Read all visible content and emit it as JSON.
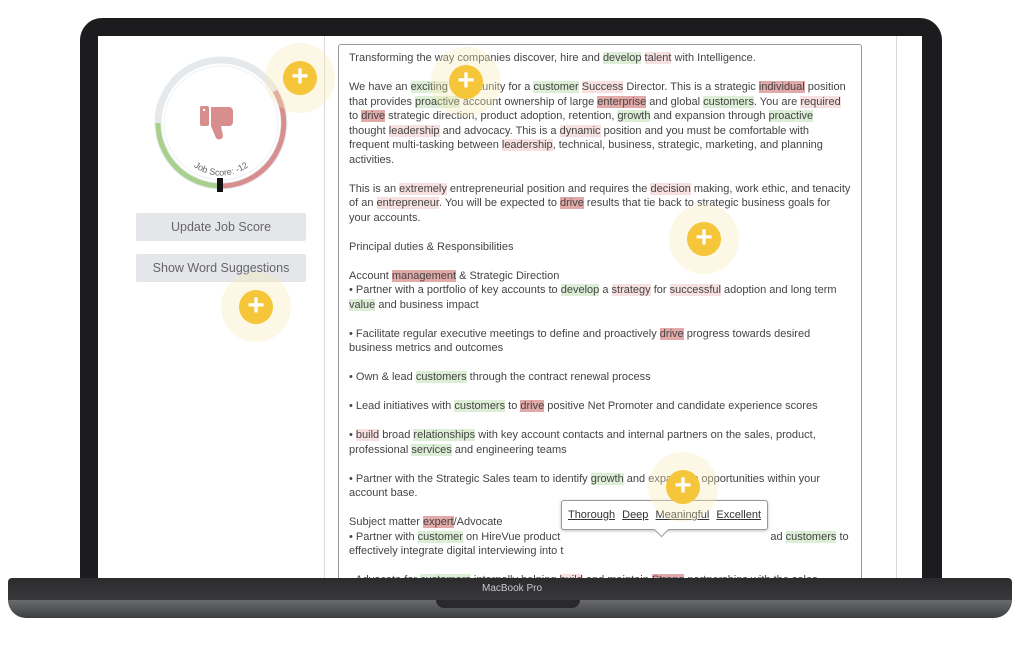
{
  "device": {
    "label": "MacBook Pro"
  },
  "score": {
    "label": "Job Score: -12",
    "value": -12,
    "icon": "thumbs-down-icon",
    "positive_color": "#a8d08d",
    "negative_color": "#d98e8e"
  },
  "buttons": {
    "update": "Update Job Score",
    "suggestions": "Show Word Suggestions"
  },
  "highlight_colors": {
    "positive": "#dcefd6",
    "negative_light": "#f7e0e0",
    "negative_strong": "#e2a9a9",
    "accent": "#f5c53a"
  },
  "tooltip": {
    "suggestions": [
      "Thorough",
      "Deep",
      "Meaningful",
      "Excellent"
    ]
  },
  "paragraphs": [
    [
      {
        "t": "Transforming the way companies discover, hire and "
      },
      {
        "t": "develop",
        "h": "g"
      },
      {
        "t": " "
      },
      {
        "t": "talent",
        "h": "r"
      },
      {
        "t": " with Intelligence."
      }
    ],
    [
      {
        "t": "We have an "
      },
      {
        "t": "exciting",
        "h": "g"
      },
      {
        "t": " opportunity for a "
      },
      {
        "t": "customer",
        "h": "g"
      },
      {
        "t": " "
      },
      {
        "t": "Success",
        "h": "r"
      },
      {
        "t": " Director. This is a strategic "
      },
      {
        "t": "individual",
        "h": "R"
      },
      {
        "t": " position that provides "
      },
      {
        "t": "proactive",
        "h": "g"
      },
      {
        "t": " account ownership of large "
      },
      {
        "t": "enterprise",
        "h": "R"
      },
      {
        "t": " and global "
      },
      {
        "t": "customers",
        "h": "g"
      },
      {
        "t": ". You are "
      },
      {
        "t": "required",
        "h": "r"
      },
      {
        "t": " to "
      },
      {
        "t": "drive",
        "h": "R"
      },
      {
        "t": " strategic direction, product adoption, retention, "
      },
      {
        "t": "growth",
        "h": "g"
      },
      {
        "t": " and expansion through "
      },
      {
        "t": "proactive",
        "h": "g"
      },
      {
        "t": " thought "
      },
      {
        "t": "leadership",
        "h": "r"
      },
      {
        "t": " and advocacy. This is a "
      },
      {
        "t": "dynamic",
        "h": "r"
      },
      {
        "t": " position and you must be comfortable with frequent multi-tasking between "
      },
      {
        "t": "leadership",
        "h": "r"
      },
      {
        "t": ", technical, business, strategic, marketing, and planning activities."
      }
    ],
    [
      {
        "t": "This is an "
      },
      {
        "t": "extremely",
        "h": "r"
      },
      {
        "t": " entrepreneurial position and requires the "
      },
      {
        "t": "decision",
        "h": "r"
      },
      {
        "t": " making, work ethic, and tenacity of an "
      },
      {
        "t": "entrepreneur",
        "h": "r"
      },
      {
        "t": ". You will be expected to "
      },
      {
        "t": "drive",
        "h": "R"
      },
      {
        "t": " results that tie back to strategic business goals for your accounts."
      }
    ],
    [
      {
        "t": "Principal duties & Responsibilities"
      }
    ],
    [
      {
        "t": "Account "
      },
      {
        "t": "management",
        "h": "R"
      },
      {
        "t": " & Strategic Direction\n• Partner with a portfolio of key accounts to "
      },
      {
        "t": "develop",
        "h": "g"
      },
      {
        "t": " a "
      },
      {
        "t": "strategy",
        "h": "r"
      },
      {
        "t": " for "
      },
      {
        "t": "successful",
        "h": "r"
      },
      {
        "t": " adoption and long term "
      },
      {
        "t": "value",
        "h": "g"
      },
      {
        "t": " and business impact"
      }
    ],
    [
      {
        "t": "• Facilitate regular executive meetings to define and proactively "
      },
      {
        "t": "drive",
        "h": "R"
      },
      {
        "t": " progress towards desired business metrics and outcomes"
      }
    ],
    [
      {
        "t": "• Own & lead "
      },
      {
        "t": "customers",
        "h": "g"
      },
      {
        "t": " through the contract renewal process"
      }
    ],
    [
      {
        "t": "• Lead initiatives with "
      },
      {
        "t": "customers",
        "h": "g"
      },
      {
        "t": " to "
      },
      {
        "t": "drive",
        "h": "R"
      },
      {
        "t": " positive Net Promoter and candidate experience scores"
      }
    ],
    [
      {
        "t": "• "
      },
      {
        "t": "build",
        "h": "r"
      },
      {
        "t": " broad "
      },
      {
        "t": "relationships",
        "h": "g"
      },
      {
        "t": " with key account contacts and internal partners on the sales, product, professional "
      },
      {
        "t": "services",
        "h": "g"
      },
      {
        "t": " and engineering teams"
      }
    ],
    [
      {
        "t": "• Partner with the Strategic Sales team to identify "
      },
      {
        "t": "growth",
        "h": "g"
      },
      {
        "t": " and expansion opportunities within your account base."
      }
    ],
    [
      {
        "t": "Subject matter "
      },
      {
        "t": "expert",
        "h": "R"
      },
      {
        "t": "/Advocate\n• Partner with "
      },
      {
        "t": "customer",
        "h": "g"
      },
      {
        "t": " on HireVue product"
      },
      {
        "gap": true
      },
      {
        "t": "ad "
      },
      {
        "t": "customers",
        "h": "g"
      },
      {
        "t": " to\neffectively integrate digital interviewing into t"
      }
    ],
    [
      {
        "t": "• Advocate for "
      },
      {
        "t": "customers",
        "h": "g"
      },
      {
        "t": " internally helping "
      },
      {
        "t": "build",
        "h": "r"
      },
      {
        "t": " and maintain "
      },
      {
        "t": "Strong",
        "h": "R"
      },
      {
        "t": " partnerships with the sales, product administration and marketing teams"
      }
    ]
  ]
}
